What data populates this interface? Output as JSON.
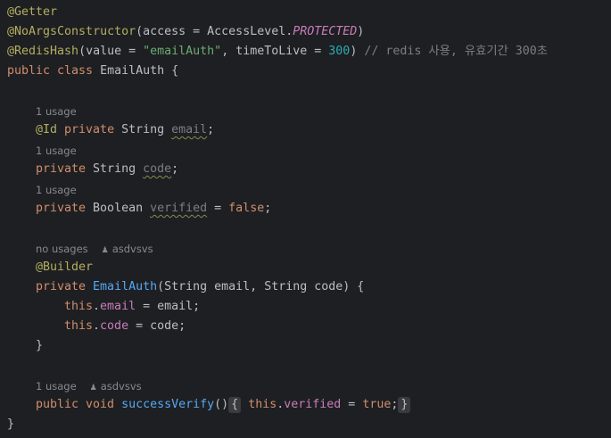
{
  "editor": {
    "hints": {
      "email_usage": "1 usage",
      "code_usage": "1 usage",
      "verified_usage": "1 usage",
      "ctor_usage": "no usages",
      "ctor_author": "asdvsvs",
      "method_usage": "1 usage",
      "method_author": "asdvsvs"
    },
    "code": {
      "l1_ann": "@Getter",
      "l2_ann": "@NoArgsConstructor",
      "l2_a": "(access = AccessLevel.",
      "l2_const": "PROTECTED",
      "l2_b": ")",
      "l3_ann": "@RedisHash",
      "l3_a": "(value = ",
      "l3_str": "\"emailAuth\"",
      "l3_b": ", timeToLive = ",
      "l3_num": "300",
      "l3_c": ") ",
      "l3_comment": "// redis 사용, 유효기간 300초",
      "l4_kw": "public class ",
      "l4_name": "EmailAuth {",
      "email_ann": "@Id ",
      "email_kw": "private ",
      "email_type": "String ",
      "email_name": "email",
      "email_end": ";",
      "code_kw": "private ",
      "code_type": "String ",
      "code_name": "code",
      "code_end": ";",
      "ver_kw": "private ",
      "ver_type": "Boolean ",
      "ver_name": "verified",
      "ver_eq": " = ",
      "ver_val": "false",
      "ver_end": ";",
      "builder_ann": "@Builder",
      "ctor_kw": "private ",
      "ctor_name": "EmailAuth",
      "ctor_params": "(String email, String code) {",
      "b1_this": "this",
      "b1_dot": ".",
      "b1_field": "email",
      "b1_rest": " = email;",
      "b2_this": "this",
      "b2_dot": ".",
      "b2_field": "code",
      "b2_rest": " = code;",
      "ctor_close": "}",
      "m_kw": "public void ",
      "m_name": "successVerify",
      "m_paren": "()",
      "m_open": "{",
      "m_this": "this",
      "m_dot": ".",
      "m_field": "verified",
      "m_eq": " = ",
      "m_val": "true",
      "m_semi": ";",
      "m_close": "}",
      "class_close": "}"
    }
  }
}
